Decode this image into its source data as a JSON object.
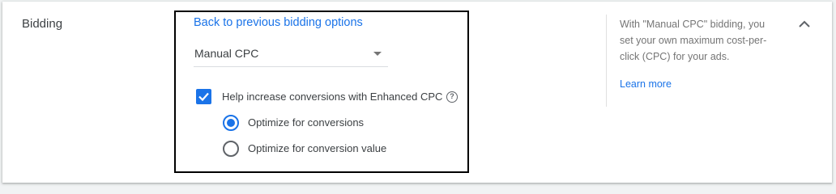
{
  "section": {
    "title": "Bidding"
  },
  "bidding": {
    "back_link": "Back to previous bidding options",
    "strategy_value": "Manual CPC",
    "enhanced_cpc": {
      "label": "Help increase conversions with Enhanced CPC",
      "checked": true,
      "help_icon": "help-circle-icon"
    },
    "options": [
      {
        "label": "Optimize for conversions",
        "selected": true
      },
      {
        "label": "Optimize for conversion value",
        "selected": false
      }
    ]
  },
  "help_panel": {
    "text": "With \"Manual CPC\" bidding, you set your own maximum cost-per-click (CPC) for your ads.",
    "learn_more": "Learn more"
  },
  "colors": {
    "accent": "#1a73e8",
    "text": "#3c4043",
    "muted": "#757575"
  },
  "icons": {
    "collapse": "chevron-up-icon",
    "dropdown": "dropdown-caret-icon",
    "check": "check-icon"
  }
}
